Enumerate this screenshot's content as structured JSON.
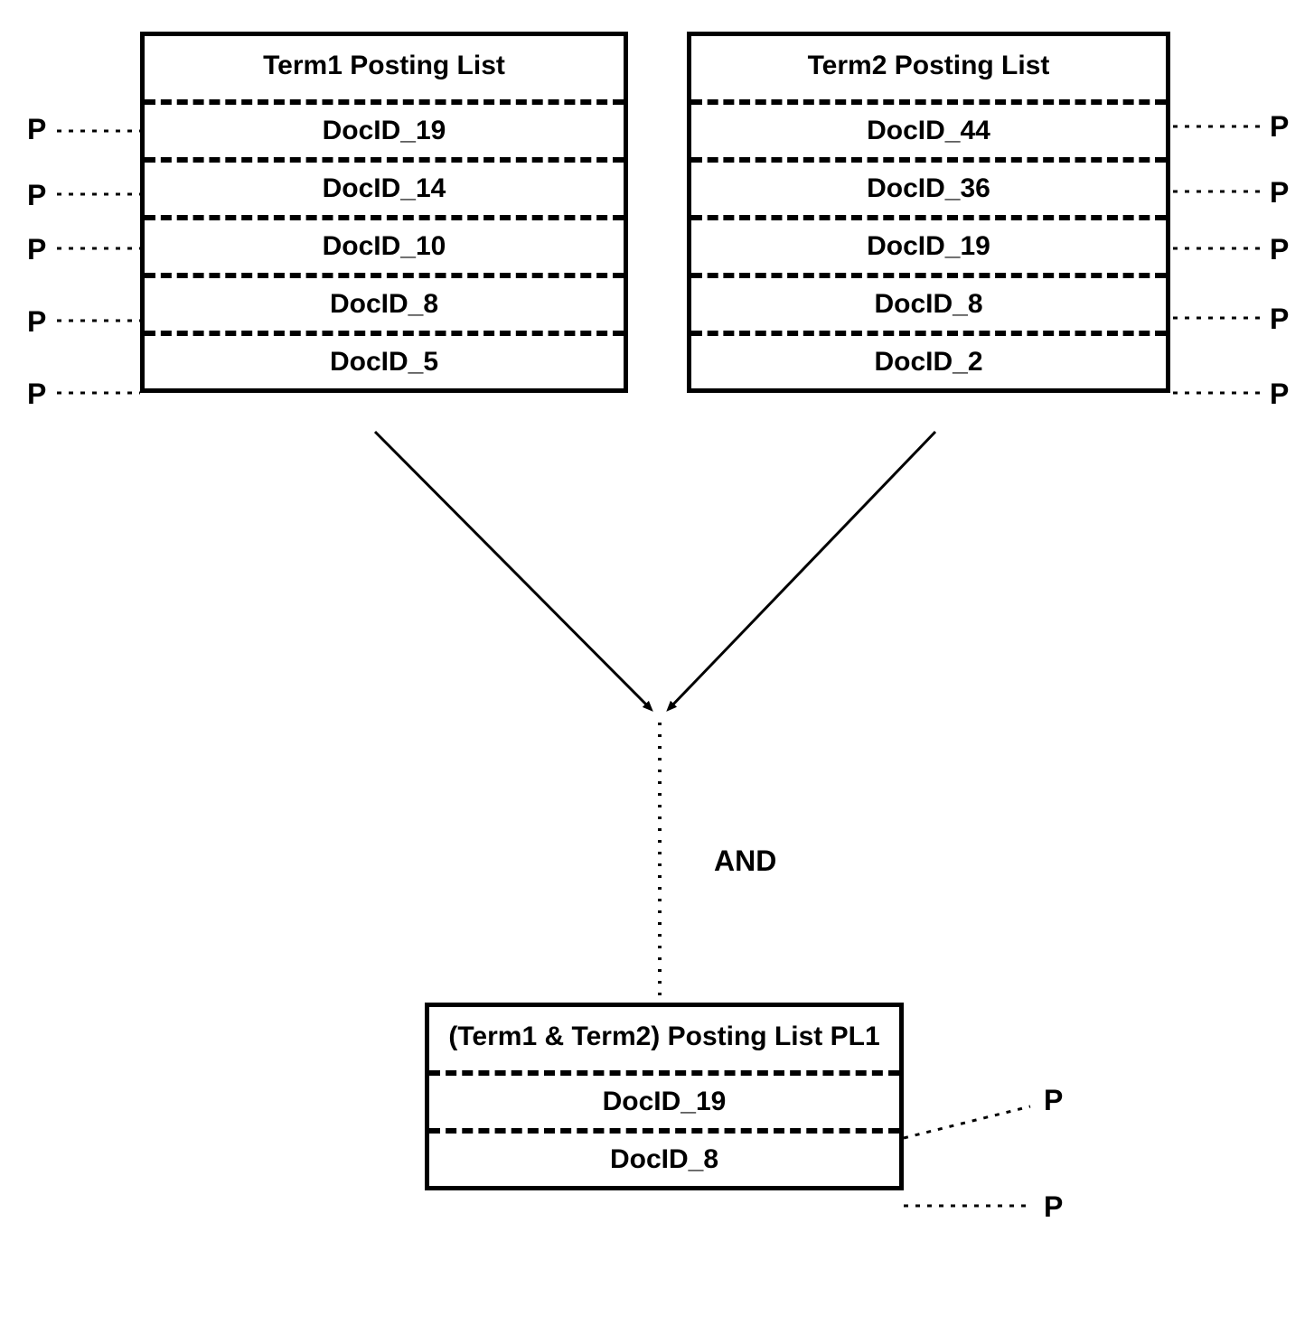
{
  "term1": {
    "title": "Term1 Posting List",
    "rows": [
      "DocID_19",
      "DocID_14",
      "DocID_10",
      "DocID_8",
      "DocID_5"
    ]
  },
  "term2": {
    "title": "Term2 Posting List",
    "rows": [
      "DocID_44",
      "DocID_36",
      "DocID_19",
      "DocID_8",
      "DocID_2"
    ]
  },
  "result": {
    "title": "(Term1 & Term2) Posting List PL1",
    "rows": [
      "DocID_19",
      "DocID_8"
    ]
  },
  "operator": "AND",
  "p_label": "P"
}
